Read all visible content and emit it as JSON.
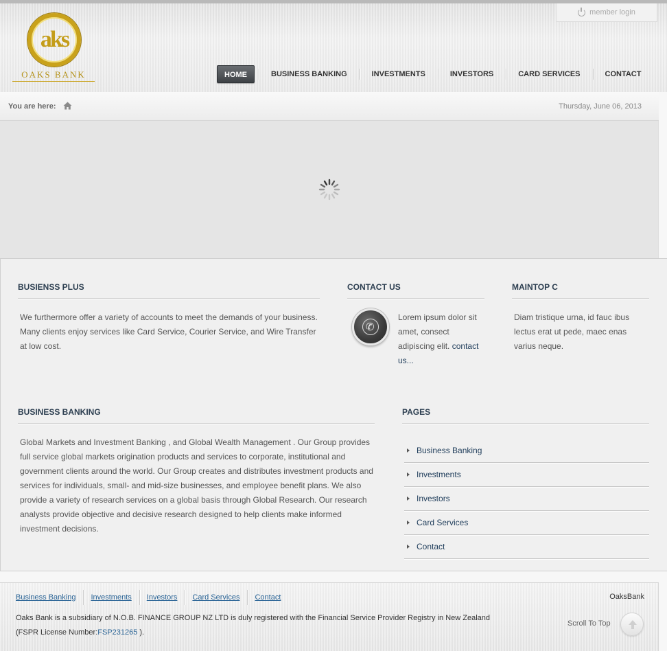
{
  "header": {
    "logo": {
      "monogram": "aks",
      "name": "OAKS BANK"
    },
    "member_login": "member login",
    "nav": [
      {
        "label": "HOME",
        "active": true
      },
      {
        "label": "BUSINESS BANKING"
      },
      {
        "label": "INVESTMENTS"
      },
      {
        "label": "INVESTORS"
      },
      {
        "label": "CARD SERVICES"
      },
      {
        "label": "CONTACT"
      }
    ]
  },
  "breadcrumb": {
    "label": "You are here:",
    "home_icon": "home-icon",
    "date": "Thursday, June 06, 2013"
  },
  "slider": {
    "state": "loading",
    "icon": "spinner-icon"
  },
  "modules": {
    "business_plus": {
      "title": "BUSIENSS PLUS",
      "text": "We furthermore offer a variety of accounts to meet the demands of your business. Many clients enjoy services like Card Service, Courier Service, and Wire Transfer at low cost."
    },
    "contact_us": {
      "title": "CONTACT US",
      "icon": "phone-icon",
      "text": "Lorem ipsum dolor sit amet, consect adipiscing elit.",
      "link": "contact us..."
    },
    "maintop_c": {
      "title": "MAINTOP C",
      "text": "Diam tristique urna, id fauc ibus lectus erat ut pede, maec enas varius neque."
    },
    "business_banking": {
      "title": "BUSINESS BANKING",
      "text": "Global Markets and Investment Banking , and Global Wealth Management . Our Group provides full service global markets origination products and services to corporate, institutional and government clients around the world. Our Group creates and distributes investment products and services for individuals, small- and mid-size businesses, and employee benefit plans. We also provide a variety of research services on a global basis through Global Research. Our research analysts provide objective and decisive research designed to help clients make informed investment decisions."
    },
    "pages": {
      "title": "PAGES",
      "items": [
        "Business Banking",
        "Investments",
        "Investors",
        "Card Services",
        "Contact"
      ]
    }
  },
  "footer": {
    "nav": [
      "Business Banking",
      "Investments",
      "Investors",
      "Card Services",
      "Contact"
    ],
    "brand": "OaksBank",
    "copyright_text": "Oaks Bank is a subsidiary of N.O.B. FINANCE GROUP NZ LTD is duly registered with the Financial Service Provider Registry in New Zealand (FSPR License Number:",
    "license_link": "FSP231265",
    "copyright_end": " ).",
    "scroll_to_top": "Scroll To Top"
  },
  "colors": {
    "accent_gold": "#c9a21b",
    "heading": "#2c3e50",
    "link": "#2a6496",
    "nav_active": "#4a4e52"
  }
}
